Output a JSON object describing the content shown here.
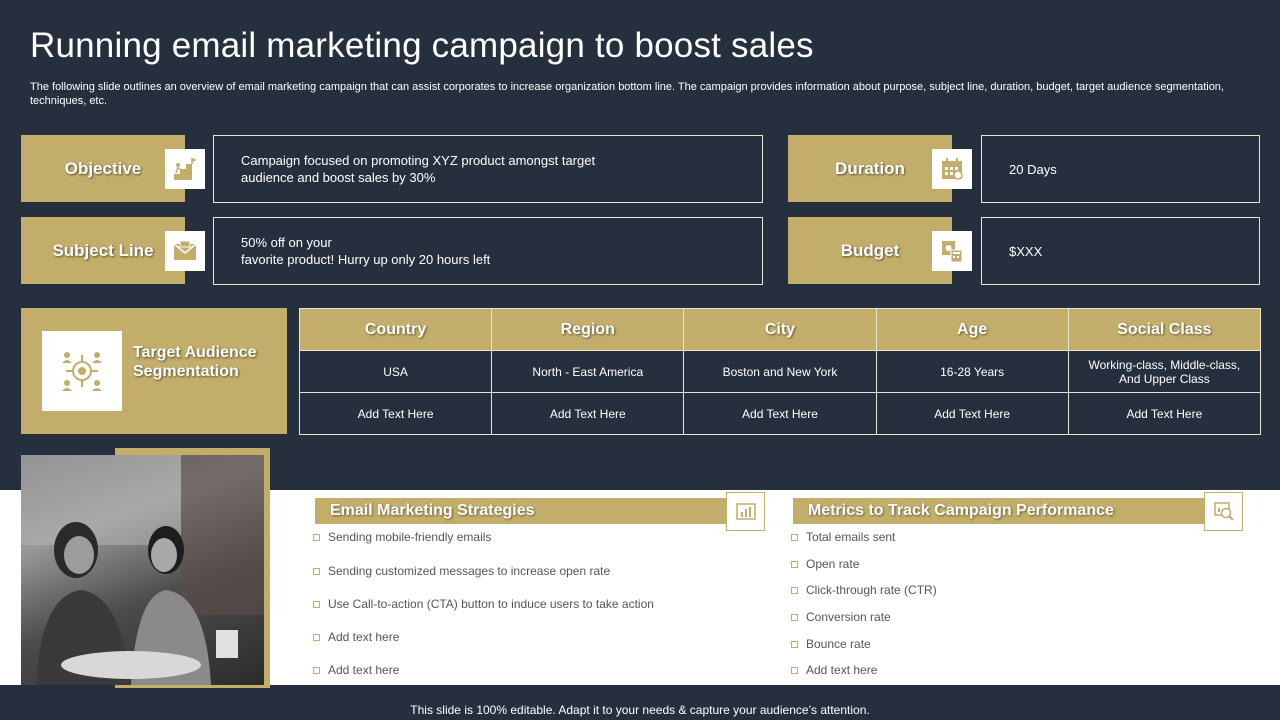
{
  "title": "Running email marketing campaign to boost sales",
  "subtitle": "The following slide outlines an overview of email marketing campaign that can assist corporates to increase organization bottom line. The campaign provides information about purpose, subject line, duration, budget, target audience segmentation, techniques, etc.",
  "objective": {
    "label": "Objective",
    "text": "Campaign focused on promoting XYZ product amongst target audience and boost sales by 30%",
    "icon": "goal-climb-icon"
  },
  "subject_line": {
    "label": "Subject Line",
    "text_line1": "50% off on your",
    "text_line2": "favorite  product! Hurry up only 20 hours left",
    "icon": "envelope-icon"
  },
  "duration": {
    "label": "Duration",
    "text": "20 Days",
    "icon": "calendar-icon"
  },
  "budget": {
    "label": "Budget",
    "text": "$XXX",
    "icon": "money-calculator-icon"
  },
  "target_audience": {
    "label": "Target Audience Segmentation",
    "icon": "audience-target-icon",
    "columns": [
      "Country",
      "Region",
      "City",
      "Age",
      "Social Class"
    ],
    "rows": [
      [
        "USA",
        "North - East America",
        "Boston and New York",
        "16-28 Years",
        "Working-class, Middle-class, And Upper Class"
      ],
      [
        "Add Text Here",
        "Add Text Here",
        "Add Text Here",
        "Add Text Here",
        "Add Text Here"
      ]
    ]
  },
  "strategies": {
    "heading": "Email Marketing Strategies",
    "icon": "email-chart-icon",
    "items": [
      "Sending mobile-friendly emails",
      "Sending customized messages to increase open rate",
      "Use Call-to-action (CTA) button to induce users to take action",
      "Add text here",
      "Add text here"
    ]
  },
  "metrics": {
    "heading": "Metrics to Track Campaign Performance",
    "icon": "analytics-magnifier-icon",
    "items": [
      "Total emails sent",
      "Open rate",
      "Click-through rate (CTR)",
      "Conversion rate",
      "Bounce rate",
      "Add text here"
    ]
  },
  "footer": "This slide is 100% editable. Adapt it to your needs & capture your audience’s attention.",
  "colors": {
    "background": "#262f3d",
    "gold": "#c3ad6a",
    "white": "#ffffff"
  }
}
